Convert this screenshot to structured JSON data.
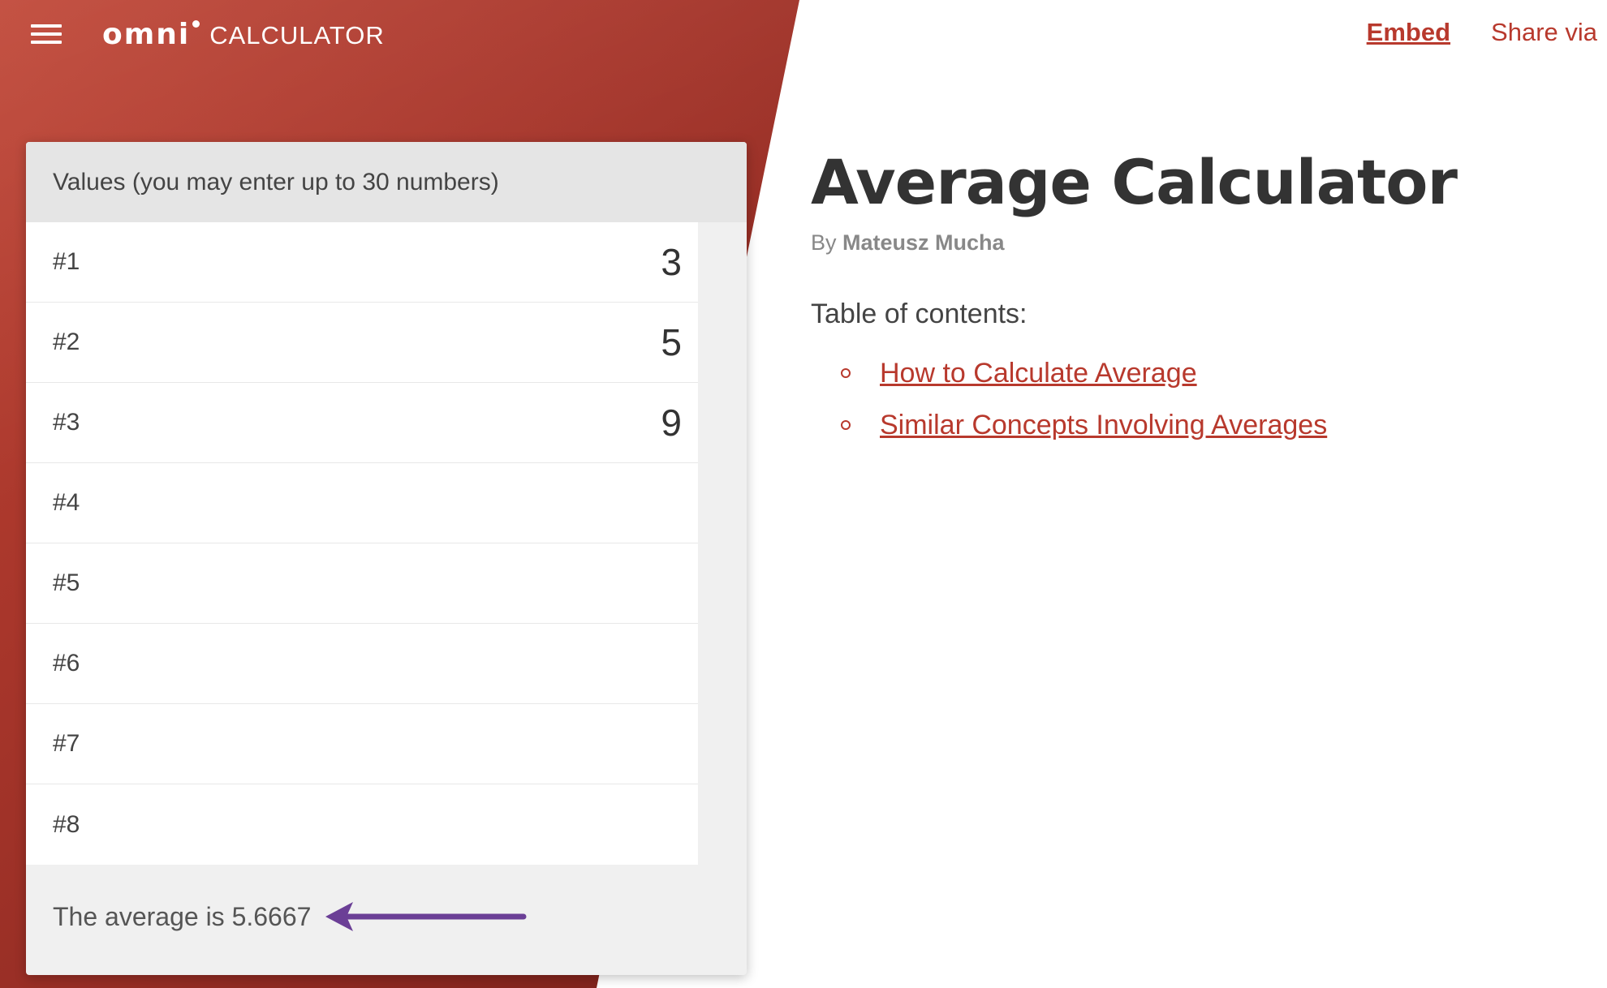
{
  "header": {
    "logo_main": "omni",
    "logo_sub": "CALCULATOR",
    "embed_label": "Embed",
    "share_label": "Share via"
  },
  "calculator": {
    "section_label": "Values (you may enter up to 30 numbers)",
    "rows": [
      {
        "label": "#1",
        "value": "3"
      },
      {
        "label": "#2",
        "value": "5"
      },
      {
        "label": "#3",
        "value": "9"
      },
      {
        "label": "#4",
        "value": ""
      },
      {
        "label": "#5",
        "value": ""
      },
      {
        "label": "#6",
        "value": ""
      },
      {
        "label": "#7",
        "value": ""
      },
      {
        "label": "#8",
        "value": ""
      }
    ],
    "result_text": "The average is 5.6667"
  },
  "article": {
    "title": "Average Calculator",
    "by_prefix": "By",
    "author": "Mateusz Mucha",
    "toc_heading": "Table of contents:",
    "toc": [
      {
        "label": "How to Calculate Average"
      },
      {
        "label": "Similar Concepts Involving Averages"
      }
    ]
  },
  "colors": {
    "brand_red": "#b8392d",
    "arrow_purple": "#6b3f96"
  },
  "icons": {
    "menu": "hamburger-menu-icon",
    "arrow": "arrow-left-annotation",
    "bullet": "circle-bullet"
  }
}
